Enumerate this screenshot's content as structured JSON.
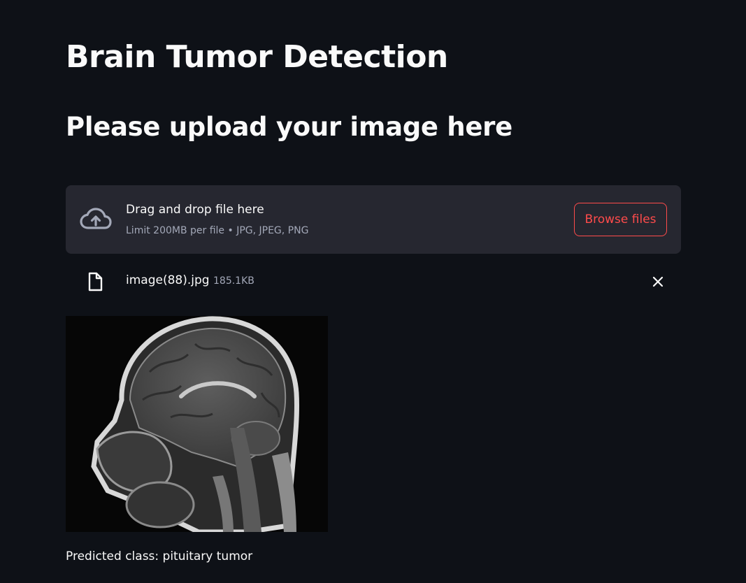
{
  "page": {
    "title": "Brain Tumor Detection",
    "subtitle": "Please upload your image here"
  },
  "uploader": {
    "dropzone_text": "Drag and drop file here",
    "limit_text": "Limit 200MB per file • JPG, JPEG, PNG",
    "browse_label": "Browse files",
    "icon": "cloud-upload-icon",
    "accent_color": "#ff4b4b"
  },
  "uploaded_file": {
    "name": "image(88).jpg",
    "size": "185.1KB",
    "icon": "file-icon",
    "remove_icon": "close-icon"
  },
  "result": {
    "prediction_text": "Predicted class: pituitary tumor"
  },
  "theme": {
    "background": "#0e1117",
    "panel": "#262730",
    "text": "#fafafa",
    "muted": "#a3a8b8"
  }
}
